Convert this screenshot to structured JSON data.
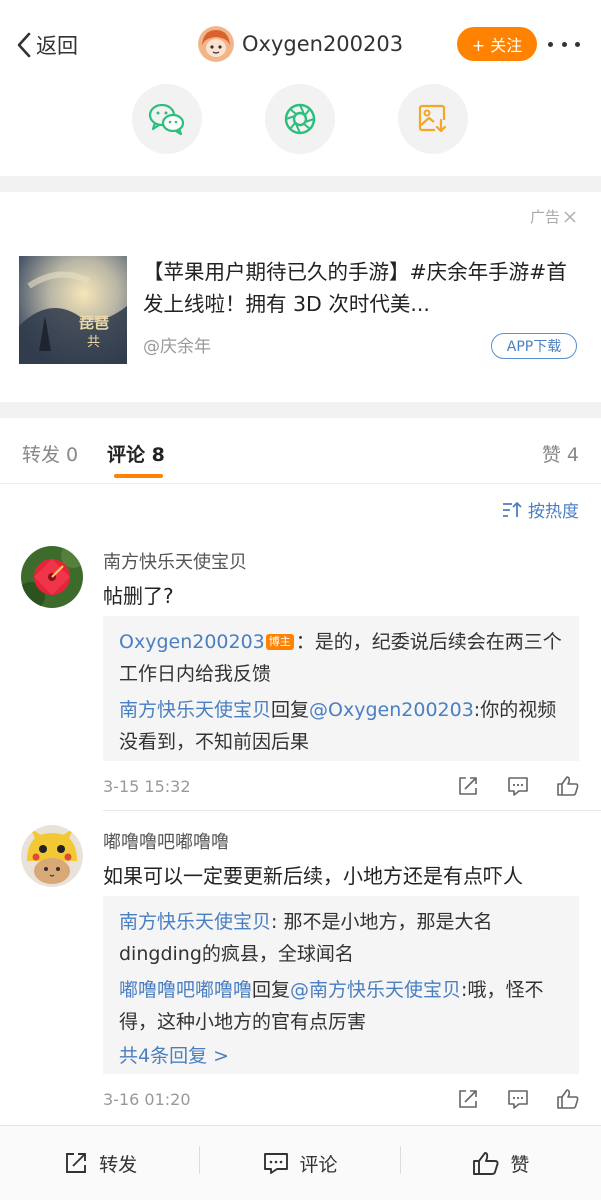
{
  "nav": {
    "back_label": "返回",
    "username": "Oxygen200203",
    "follow_label": "+ 关注"
  },
  "share": {
    "icons": [
      "wechat-icon",
      "moments-icon",
      "save-image-icon"
    ]
  },
  "ad": {
    "tag": "广告",
    "title": "【苹果用户期待已久的手游】#庆余年手游#首发上线啦！拥有 3D 次时代美...",
    "source": "@庆余年",
    "app_button": "APP下载"
  },
  "tabs": {
    "repost": "转发 0",
    "comment": "评论 8",
    "like": "赞 4"
  },
  "sort_label": "按热度",
  "comments": [
    {
      "name": "南方快乐天使宝贝",
      "text": "帖删了?",
      "replies": [
        {
          "user": "Oxygen200203",
          "badge": "博主",
          "text": "：是的，纪委说后续会在两三个工作日内给我反馈"
        },
        {
          "user": "南方快乐天使宝贝",
          "verb": "回复",
          "mention": "@Oxygen200203",
          "text": ":你的视频没看到，不知前因后果"
        }
      ],
      "time": "3-15 15:32"
    },
    {
      "name": "嘟噜噜吧嘟噜噜",
      "text": "如果可以一定要更新后续，小地方还是有点吓人",
      "replies": [
        {
          "user": "南方快乐天使宝贝",
          "text": ": 那不是小地方，那是大名dingding的疯县，全球闻名"
        },
        {
          "user": "嘟噜噜吧嘟噜噜",
          "verb": "回复",
          "mention": "@南方快乐天使宝贝",
          "text": ":哦，怪不得，这种小地方的官有点厉害"
        }
      ],
      "more_replies": "共4条回复 >",
      "time": "3-16 01:20"
    }
  ],
  "bottom": {
    "repost": "转发",
    "comment": "评论",
    "like": "赞"
  },
  "colors": {
    "accent": "#ff8200",
    "link": "#4a7fc1",
    "share_green": "#2dbe7e",
    "share_orange": "#f5a623"
  }
}
